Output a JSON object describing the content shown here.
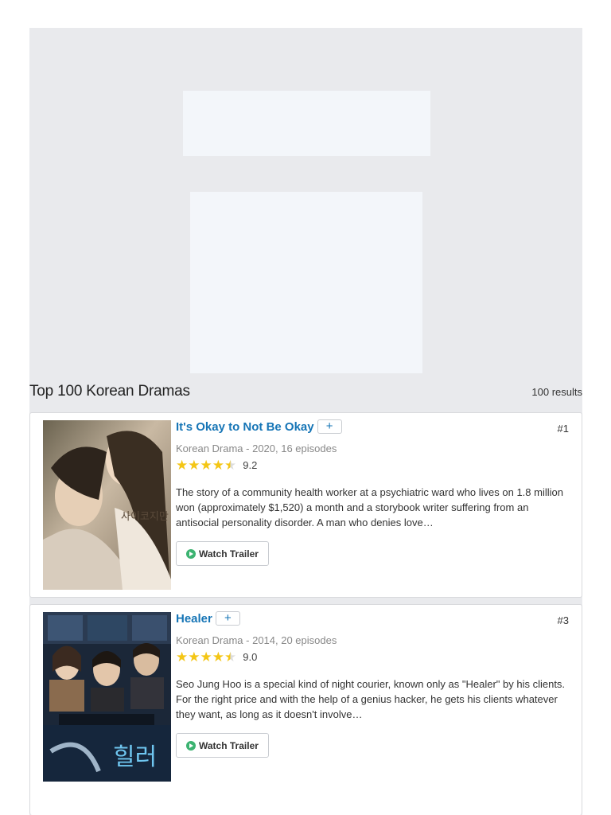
{
  "list": {
    "title": "Top 100 Korean Dramas",
    "results": "100 results"
  },
  "items": [
    {
      "title": "It's Okay to Not Be Okay",
      "add_label": "+",
      "rank": "#1",
      "meta": "Korean Drama - 2020, 16 episodes",
      "stars": [
        "★",
        "★",
        "★",
        "★",
        "★"
      ],
      "rating": 4.5,
      "score": "9.2",
      "description": "The story of a community health worker at a psychiatric ward who lives on 1.8 million won (approximately $1,520) a month and a storybook writer suffering from an antisocial personality disorder. A man who denies love…",
      "trailer_label": "Watch Trailer",
      "poster_text": "사이코지만 괜찮아"
    },
    {
      "title": "Healer",
      "add_label": "+",
      "rank": "#3",
      "meta": "Korean Drama - 2014, 20 episodes",
      "stars": [
        "★",
        "★",
        "★",
        "★",
        "★"
      ],
      "rating": 4.5,
      "score": "9.0",
      "description": "Seo Jung Hoo is a special kind of night courier, known only as \"Healer\" by his clients. For the right price and with the help of a genius hacker, he gets his clients whatever they want, as long as it doesn't involve…",
      "trailer_label": "Watch Trailer",
      "poster_text": "힐러"
    }
  ],
  "colors": {
    "link": "#1675b6",
    "star": "#f4c615",
    "play": "#3cb371",
    "page_bg": "#e9eaed",
    "ad_bg": "#f3f6fa"
  }
}
